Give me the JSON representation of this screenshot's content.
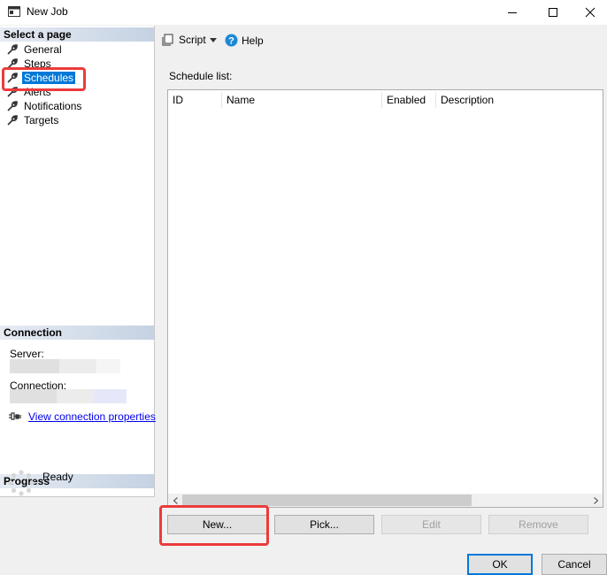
{
  "window": {
    "title": "New Job"
  },
  "sidebar": {
    "select_page_header": "Select a page",
    "pages": [
      {
        "label": "General",
        "icon": "wrench-icon"
      },
      {
        "label": "Steps",
        "icon": "wrench-icon"
      },
      {
        "label": "Schedules",
        "icon": "wrench-icon",
        "selected": true
      },
      {
        "label": "Alerts",
        "icon": "wrench-icon"
      },
      {
        "label": "Notifications",
        "icon": "wrench-icon"
      },
      {
        "label": "Targets",
        "icon": "wrench-icon"
      }
    ],
    "connection_header": "Connection",
    "server_label": "Server:",
    "connection_label": "Connection:",
    "view_connection_properties": "View connection properties",
    "progress_header": "Progress",
    "progress_status": "Ready"
  },
  "toolbar": {
    "script_label": "Script",
    "help_label": "Help"
  },
  "schedules": {
    "list_label": "Schedule list:",
    "columns": [
      "ID",
      "Name",
      "Enabled",
      "Description"
    ],
    "rows": []
  },
  "actions": {
    "new_label": "New...",
    "pick_label": "Pick...",
    "edit_label": "Edit",
    "remove_label": "Remove"
  },
  "footer": {
    "ok_label": "OK",
    "cancel_label": "Cancel"
  },
  "colors": {
    "selection": "#0078d7",
    "highlight_box": "#ec3b3b",
    "link": "#0000ee"
  }
}
